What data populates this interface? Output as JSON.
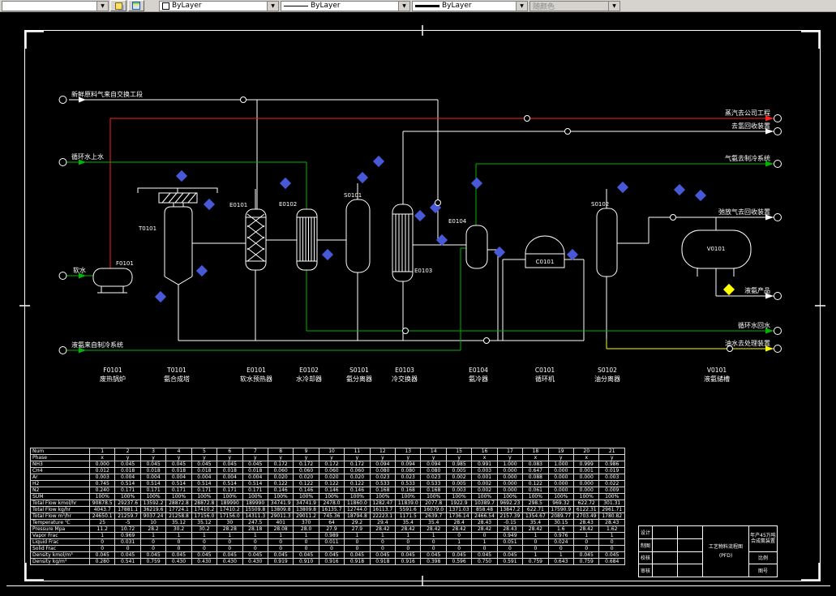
{
  "toolbar": {
    "color_value": "ByLayer",
    "linetype_value": "ByLayer",
    "lineweight_value": "ByLayer",
    "plot_style_value": "随颜色"
  },
  "colors": {
    "canvas_background": "#000000",
    "process_line": "#ffffff",
    "steam_line": "#ff2020",
    "water_line": "#00b400",
    "oil_line": "#ffff00",
    "instrument": "#4859d8",
    "toolbar_background": "#d6d3ce"
  },
  "io": {
    "left": [
      {
        "label": "新鲜原料气来自交换工段",
        "color": "white"
      },
      {
        "label": "循环水上水",
        "color": "green"
      },
      {
        "label": "软水",
        "color": "green"
      },
      {
        "label": "液氨来自制冷系统",
        "color": "green"
      }
    ],
    "right": [
      {
        "label": "蒸汽去公司工程",
        "color": "red"
      },
      {
        "label": "去氢回收装置",
        "color": "white"
      },
      {
        "label": "气氨去制冷系统",
        "color": "green"
      },
      {
        "label": "弛放气去回收装置",
        "color": "white"
      },
      {
        "label": "液氨产品",
        "color": "white"
      },
      {
        "label": "循环水回水",
        "color": "green"
      },
      {
        "label": "油水去处理装置",
        "color": "yellow"
      }
    ]
  },
  "equipment": [
    {
      "id": "F0101",
      "name": "废热锅炉"
    },
    {
      "id": "T0101",
      "name": "氨合成塔"
    },
    {
      "id": "E0101",
      "name": "软水预热器"
    },
    {
      "id": "E0102",
      "name": "水冷却器"
    },
    {
      "id": "S0101",
      "name": "氨分离器"
    },
    {
      "id": "E0103",
      "name": "冷交换器"
    },
    {
      "id": "E0104",
      "name": "氨冷器"
    },
    {
      "id": "C0101",
      "name": "循环机"
    },
    {
      "id": "S0102",
      "name": "油分离器"
    },
    {
      "id": "V0101",
      "name": "液氨储槽"
    }
  ],
  "table": {
    "rows": [
      {
        "label": "Num",
        "values": [
          "1",
          "2",
          "3",
          "4",
          "5",
          "6",
          "7",
          "8",
          "9",
          "10",
          "11",
          "12",
          "13",
          "14",
          "15",
          "16",
          "17",
          "18",
          "19",
          "20",
          "21"
        ]
      },
      {
        "label": "Phase",
        "values": [
          "x",
          "y",
          "y",
          "y",
          "y",
          "y",
          "y",
          "y",
          "y",
          "y",
          "y",
          "y",
          "y",
          "y",
          "y",
          "x",
          "y",
          "x",
          "y",
          "x",
          "y"
        ]
      },
      {
        "label": "NH3",
        "values": [
          "0.000",
          "0.045",
          "0.045",
          "0.045",
          "0.045",
          "0.045",
          "0.045",
          "0.172",
          "0.172",
          "0.172",
          "0.172",
          "0.094",
          "0.094",
          "0.094",
          "0.985",
          "0.991",
          "1.000",
          "0.083",
          "1.000",
          "0.999",
          "0.986"
        ]
      },
      {
        "label": "CH4",
        "values": [
          "0.012",
          "0.018",
          "0.018",
          "0.018",
          "0.018",
          "0.018",
          "0.018",
          "0.060",
          "0.060",
          "0.060",
          "0.060",
          "0.080",
          "0.080",
          "0.080",
          "0.005",
          "0.003",
          "0.000",
          "0.647",
          "0.000",
          "0.001",
          "0.019"
        ]
      },
      {
        "label": "Ar",
        "values": [
          "0.003",
          "0.004",
          "0.004",
          "0.004",
          "0.004",
          "0.004",
          "0.004",
          "0.020",
          "0.020",
          "0.020",
          "0.020",
          "0.023",
          "0.023",
          "0.023",
          "0.002",
          "0.001",
          "0.000",
          "0.088",
          "0.000",
          "0.000",
          "0.003"
        ]
      },
      {
        "label": "H2",
        "values": [
          "0.745",
          "0.514",
          "0.514",
          "0.514",
          "0.514",
          "0.514",
          "0.514",
          "0.122",
          "0.122",
          "0.122",
          "0.122",
          "0.533",
          "0.533",
          "0.533",
          "0.005",
          "0.002",
          "0.000",
          "0.122",
          "0.000",
          "0.000",
          "0.022"
        ]
      },
      {
        "label": "N2",
        "values": [
          "0.240",
          "0.171",
          "0.171",
          "0.171",
          "0.171",
          "0.171",
          "0.171",
          "0.146",
          "0.146",
          "0.146",
          "0.146",
          "0.168",
          "0.168",
          "0.168",
          "0.003",
          "0.002",
          "0.000",
          "0.061",
          "0.000",
          "0.000",
          "0.009"
        ]
      },
      {
        "label": "SUM",
        "values": [
          "100%",
          "100%",
          "100%",
          "100%",
          "100%",
          "100%",
          "100%",
          "100%",
          "100%",
          "100%",
          "100%",
          "100%",
          "100%",
          "100%",
          "100%",
          "100%",
          "100%",
          "100%",
          "100%",
          "100%",
          "100%"
        ]
      },
      {
        "label": "Total Flow kmol/hr",
        "values": [
          "90878.5",
          "29237.6",
          "13592.2",
          "28872.8",
          "28872.8",
          "189990",
          "189990",
          "34741.9",
          "34741.9",
          "2478.0",
          "11860.0",
          "1282.47",
          "11839.0",
          "2077.8",
          "1922.9",
          "10389.7",
          "9692.23",
          "298.5",
          "969.32",
          "622.72",
          "301.31"
        ]
      },
      {
        "label": "Total Flow kg/hr",
        "values": [
          "4043.7",
          "17881.1",
          "36219.6",
          "17724.1",
          "17410.2",
          "17410.2",
          "15509.8",
          "13809.8",
          "13809.8",
          "16135.7",
          "12744.0",
          "16113.7",
          "5591.6",
          "16079.0",
          "1371.03",
          "858.48",
          "13847.2",
          "622.71",
          "17590.9",
          "6122.31",
          "2961.71"
        ]
      },
      {
        "label": "Total Flow m³/hr",
        "values": [
          "24650.1",
          "21259.7",
          "9037.24",
          "21258.8",
          "17156.0",
          "17156.0",
          "14311.3",
          "29011.3",
          "29011.2",
          "745.36",
          "18794.8",
          "22223.1",
          "1171.5",
          "2639.7",
          "1736.14",
          "2466.54",
          "2157.39",
          "1354.67",
          "2089.77",
          "2703.49",
          "1780.82"
        ]
      },
      {
        "label": "Temperature ℃",
        "values": [
          "25",
          "-5",
          "10",
          "35.12",
          "35.12",
          "30",
          "247.5",
          "401",
          "370",
          "64",
          "29.2",
          "29.4",
          "35.4",
          "35.4",
          "28.4",
          "28.43",
          "-0.15",
          "35.4",
          "30.15",
          "28.43",
          "28.43"
        ]
      },
      {
        "label": "Pressure Mpa",
        "values": [
          "11.2",
          "10.72",
          "28.2",
          "30.2",
          "30.2",
          "28.28",
          "28.18",
          "28.08",
          "28.0",
          "27.9",
          "27.9",
          "28.42",
          "28.42",
          "28.42",
          "28.42",
          "28.42",
          "28.43",
          "28.42",
          "1.6",
          "28.42",
          "1.62"
        ]
      },
      {
        "label": "Vapor Frac",
        "values": [
          "1",
          "0.969",
          "1",
          "1",
          "1",
          "1",
          "1",
          "1",
          "1",
          "0.989",
          "1",
          "1",
          "1",
          "1",
          "0",
          "0",
          "0.949",
          "1",
          "0.976",
          "1",
          "1"
        ]
      },
      {
        "label": "Liquid Frac",
        "values": [
          "0",
          "0.031",
          "0",
          "0",
          "0",
          "0",
          "0",
          "0",
          "0",
          "0.011",
          "0",
          "0",
          "0",
          "0",
          "1",
          "1",
          "0.051",
          "0",
          "0.024",
          "0",
          "0"
        ]
      },
      {
        "label": "Solid Frac",
        "values": [
          "0",
          "0",
          "0",
          "0",
          "0",
          "0",
          "0",
          "0",
          "0",
          "0",
          "0",
          "0",
          "0",
          "0",
          "0",
          "0",
          "0",
          "0",
          "0",
          "0",
          "0"
        ]
      },
      {
        "label": "Density kmol/m³",
        "values": [
          "0.045",
          "0.045",
          "0.045",
          "0.045",
          "0.045",
          "0.045",
          "0.045",
          "0.045",
          "0.045",
          "0.045",
          "0.045",
          "0.045",
          "0.045",
          "0.045",
          "0.045",
          "0.045",
          "0.045",
          "1",
          "1",
          "0.045",
          "0.045"
        ]
      },
      {
        "label": "Density kg/m³",
        "values": [
          "0.280",
          "0.541",
          "0.759",
          "0.430",
          "0.430",
          "0.430",
          "0.430",
          "0.919",
          "0.910",
          "0.916",
          "0.918",
          "0.918",
          "0.916",
          "0.398",
          "0.596",
          "0.750",
          "0.591",
          "0.759",
          "0.643",
          "0.759",
          "0.684"
        ]
      }
    ]
  },
  "title_block": {
    "title_line1": "工艺物料流程图",
    "title_line2": "(PFD)",
    "project": "年产45万吨合成氨装置",
    "left_rows": [
      {
        "label": "设计"
      },
      {
        "label": "制图"
      },
      {
        "label": "校核"
      },
      {
        "label": "审核"
      }
    ],
    "scale_label": "比例",
    "sheet_label": "图号"
  }
}
